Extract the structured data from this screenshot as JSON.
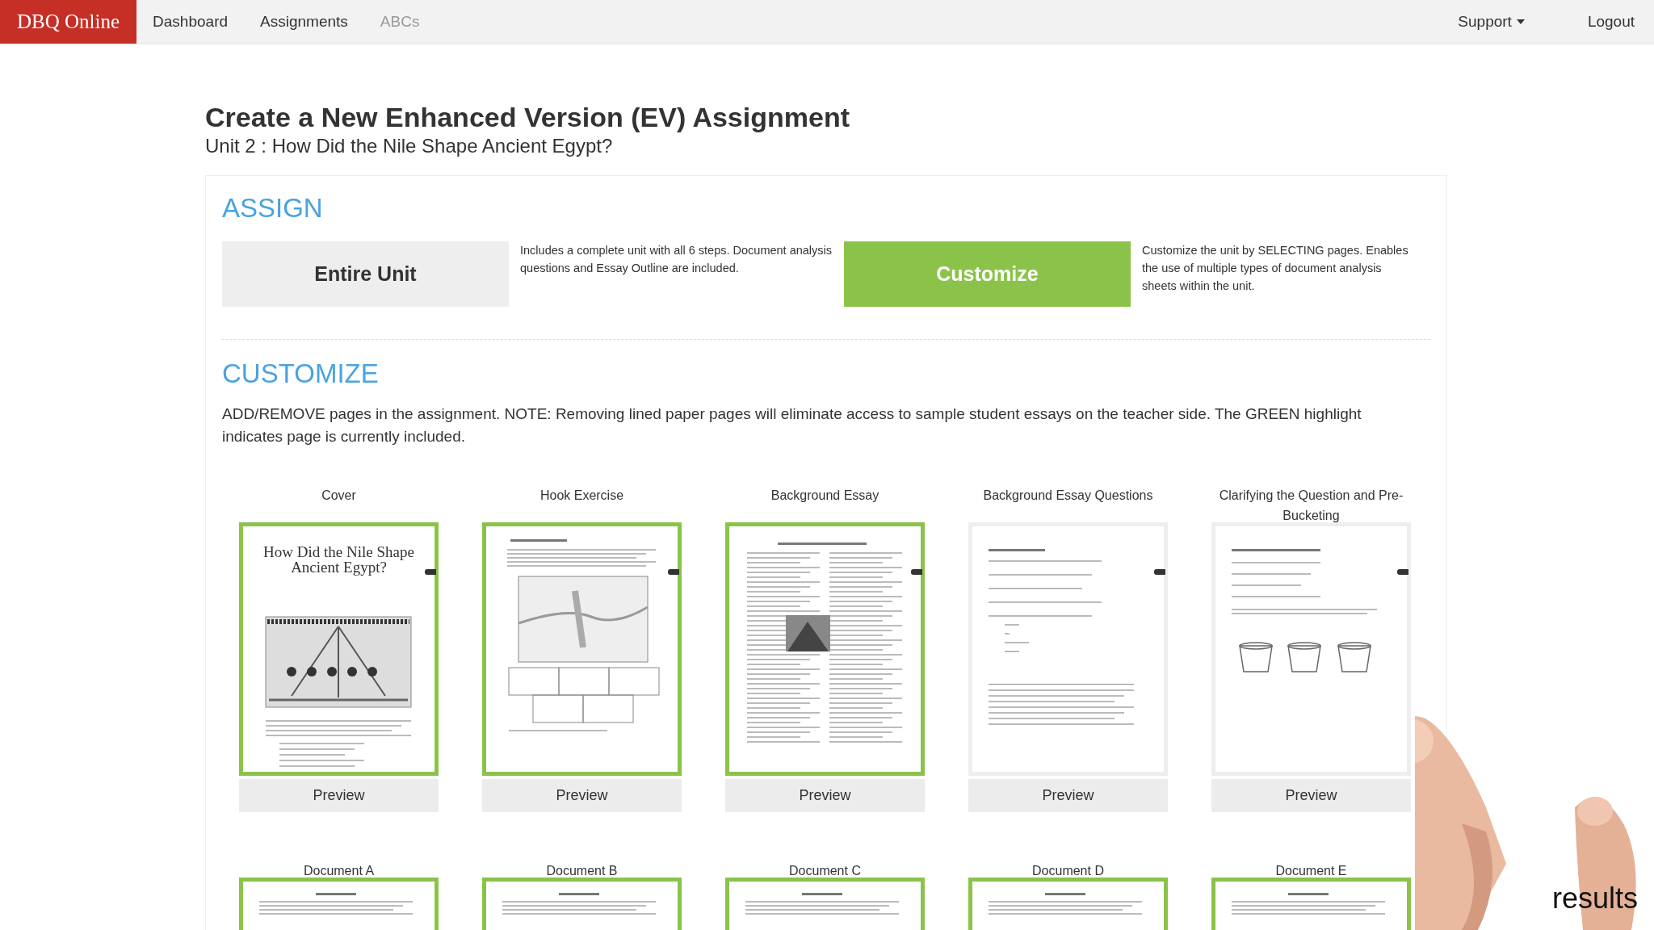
{
  "nav": {
    "brand": "DBQ Online",
    "links": [
      {
        "label": "Dashboard",
        "disabled": false
      },
      {
        "label": "Assignments",
        "disabled": false
      },
      {
        "label": "ABCs",
        "disabled": true
      }
    ],
    "support": "Support",
    "logout": "Logout"
  },
  "heading": "Create a New Enhanced Version (EV) Assignment",
  "subtitle": "Unit 2 : How Did the Nile Shape Ancient Egypt?",
  "assign": {
    "title": "ASSIGN",
    "options": [
      {
        "label": "Entire Unit",
        "description": "Includes a complete unit with all 6 steps. Document analysis questions and Essay Outline are included.",
        "selected": false
      },
      {
        "label": "Customize",
        "description": "Customize the unit by SELECTING pages. Enables the use of multiple types of document analysis sheets within the unit.",
        "selected": true
      }
    ]
  },
  "customize": {
    "title": "CUSTOMIZE",
    "note": "ADD/REMOVE pages in the assignment. NOTE: Removing lined paper pages will eliminate access to sample student essays on the teacher side. The GREEN highlight indicates page is currently included.",
    "pages": [
      {
        "label": "Cover",
        "kind": "cover",
        "thumbnail_title": "How Did the Nile Shape Ancient Egypt?",
        "included": true,
        "preview_label": "Preview"
      },
      {
        "label": "Hook Exercise",
        "kind": "map",
        "included": true,
        "preview_label": "Preview"
      },
      {
        "label": "Background Essay",
        "kind": "essay",
        "included": true,
        "preview_label": "Preview"
      },
      {
        "label": "Background Essay Questions",
        "kind": "questions",
        "included": false,
        "preview_label": "Preview"
      },
      {
        "label": "Clarifying the Question and Pre-Bucketing",
        "kind": "buckets",
        "included": false,
        "preview_label": "Preview"
      }
    ],
    "documents": [
      {
        "label": "Document A",
        "included": true
      },
      {
        "label": "Document B",
        "included": true
      },
      {
        "label": "Document C",
        "included": true
      },
      {
        "label": "Document D",
        "included": true
      },
      {
        "label": "Document E",
        "included": true
      }
    ]
  },
  "caption": "results"
}
